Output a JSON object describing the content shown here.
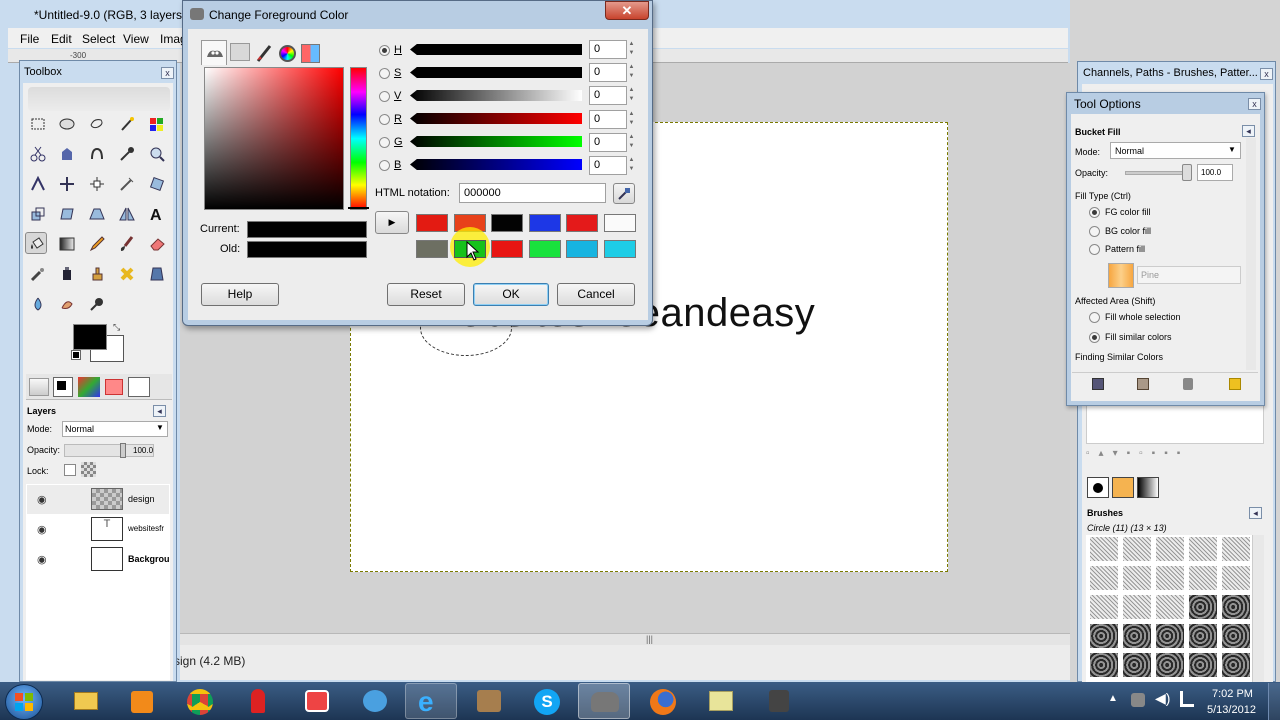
{
  "main_window": {
    "title": "*Untitled-9.0 (RGB, 3 layers) 6",
    "menu": [
      "File",
      "Edit",
      "Select",
      "View",
      "Imag"
    ],
    "ruler_mark": "-300",
    "canvas_text": "websitesfreeandeasy",
    "status": "sign (4.2 MB)"
  },
  "toolbox": {
    "title": "Toolbox",
    "layers": {
      "heading": "Layers",
      "mode_label": "Mode:",
      "mode_value": "Normal",
      "opacity_label": "Opacity:",
      "opacity_value": "100.0",
      "lock_label": "Lock:",
      "items": [
        {
          "name": "design",
          "bold": false
        },
        {
          "name": "websitesfr",
          "bold": false
        },
        {
          "name": "Backgrou",
          "bold": true
        }
      ]
    }
  },
  "dialog": {
    "title": "Change Foreground Color",
    "channels": [
      {
        "label": "H",
        "value": "0",
        "selected": true
      },
      {
        "label": "S",
        "value": "0",
        "selected": false
      },
      {
        "label": "V",
        "value": "0",
        "selected": false
      },
      {
        "label": "R",
        "value": "0",
        "selected": false
      },
      {
        "label": "G",
        "value": "0",
        "selected": false
      },
      {
        "label": "B",
        "value": "0",
        "selected": false
      }
    ],
    "html_label": "HTML notation:",
    "html_value": "000000",
    "current_label": "Current:",
    "old_label": "Old:",
    "history_colors": [
      "#e31b12",
      "#e8411a",
      "#030303",
      "#1d37e6",
      "#e41a1a",
      "#fafafa",
      "#6d6f62",
      "#17c21b",
      "#e81512",
      "#19e23d",
      "#17b4e0",
      "#1ecde6"
    ],
    "buttons": {
      "help": "Help",
      "reset": "Reset",
      "ok": "OK",
      "cancel": "Cancel"
    }
  },
  "dock": {
    "title": "Channels, Paths - Brushes, Patter...",
    "tool_options": {
      "title": "Tool Options",
      "tool": "Bucket Fill",
      "mode_label": "Mode:",
      "mode_value": "Normal",
      "opacity_label": "Opacity:",
      "opacity_value": "100.0",
      "fill_type_label": "Fill Type  (Ctrl)",
      "fill_options": [
        {
          "label": "FG color fill",
          "selected": true
        },
        {
          "label": "BG color fill",
          "selected": false
        },
        {
          "label": "Pattern fill",
          "selected": false
        }
      ],
      "pattern_name": "Pine",
      "affected_label": "Affected Area  (Shift)",
      "affected_options": [
        {
          "label": "Fill whole selection",
          "selected": false
        },
        {
          "label": "Fill similar colors",
          "selected": true
        }
      ],
      "finding_label": "Finding Similar Colors"
    },
    "brushes": {
      "heading": "Brushes",
      "current": "Circle (11) (13 × 13)"
    }
  },
  "taskbar": {
    "time": "7:02 PM",
    "date": "5/13/2012"
  }
}
